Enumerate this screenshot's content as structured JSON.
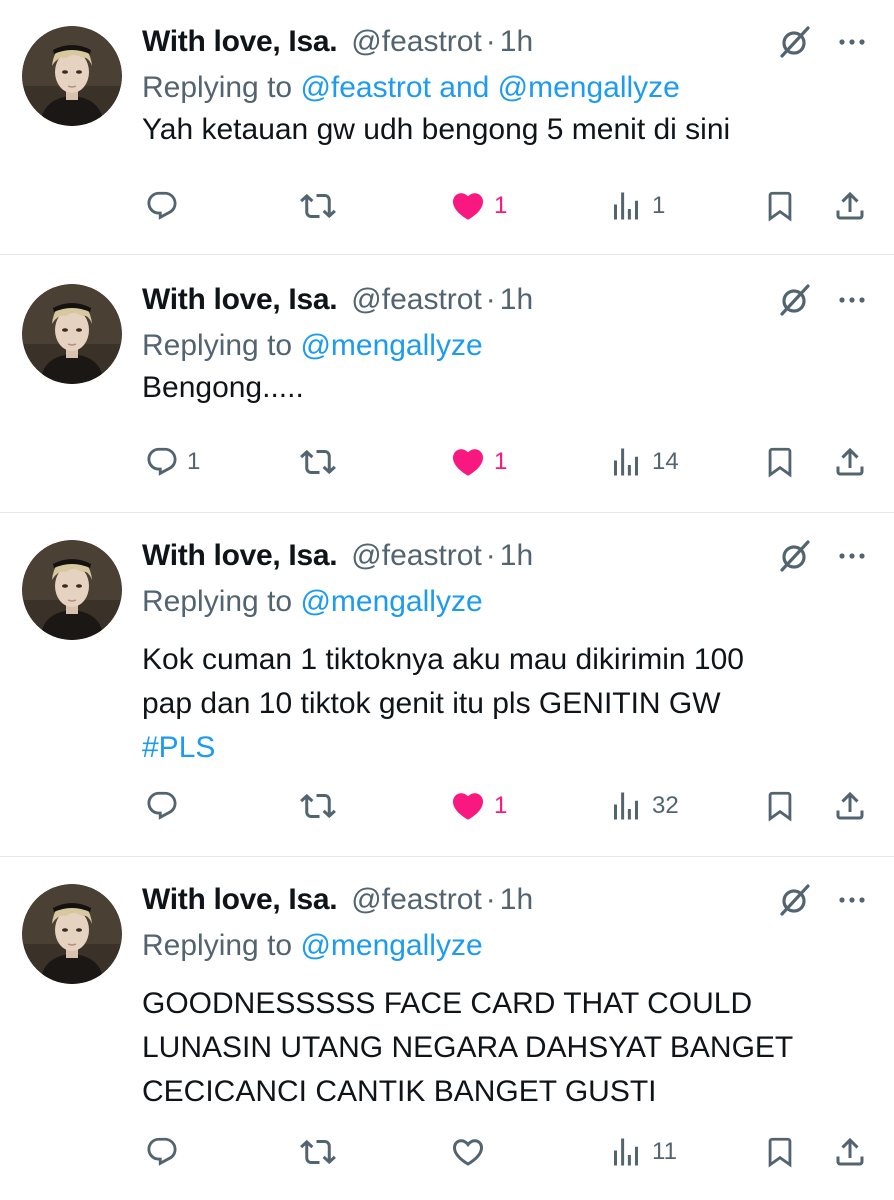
{
  "tweets": [
    {
      "name": "With love, Isa.",
      "handle": "@feastrot",
      "separator": "·",
      "time": "1h",
      "replying_prefix": "Replying to ",
      "replying_to": "@feastrot and @mengallyze",
      "text_lines": [
        "Yah ketauan gw udh bengong 5 menit di sini"
      ],
      "hashtag": "",
      "replies": "",
      "reposts": "",
      "likes": "1",
      "liked": true,
      "views": "1"
    },
    {
      "name": "With love, Isa.",
      "handle": "@feastrot",
      "separator": "·",
      "time": "1h",
      "replying_prefix": "Replying to ",
      "replying_to": "@mengallyze",
      "text_lines": [
        "Bengong....."
      ],
      "hashtag": "",
      "replies": "1",
      "reposts": "",
      "likes": "1",
      "liked": true,
      "views": "14"
    },
    {
      "name": "With love, Isa.",
      "handle": "@feastrot",
      "separator": "·",
      "time": "1h",
      "replying_prefix": "Replying to ",
      "replying_to": "@mengallyze",
      "text_lines": [
        "Kok cuman 1 tiktoknya aku mau dikirimin 100",
        "pap dan 10 tiktok genit itu pls GENITIN GW"
      ],
      "hashtag": "#PLS",
      "replies": "",
      "reposts": "",
      "likes": "1",
      "liked": true,
      "views": "32"
    },
    {
      "name": "With love, Isa.",
      "handle": "@feastrot",
      "separator": "·",
      "time": "1h",
      "replying_prefix": "Replying to ",
      "replying_to": "@mengallyze",
      "text_lines": [
        "GOODNESSSSS FACE CARD THAT COULD",
        "LUNASIN UTANG NEGARA DAHSYAT BANGET",
        "CECICANCI CANTIK BANGET GUSTI"
      ],
      "hashtag": "",
      "replies": "",
      "reposts": "",
      "likes": "",
      "liked": false,
      "views": "11"
    }
  ],
  "icons": {
    "reply": "reply-icon",
    "repost": "repost-icon",
    "like": "heart-icon",
    "views": "views-icon",
    "bookmark": "bookmark-icon",
    "share": "share-icon",
    "grok": "grok-icon",
    "more": "more-icon"
  },
  "colors": {
    "text": "#0f1419",
    "secondary": "#536471",
    "link": "#1d9bf0",
    "like": "#f91880",
    "divider": "#e6e9ec"
  }
}
